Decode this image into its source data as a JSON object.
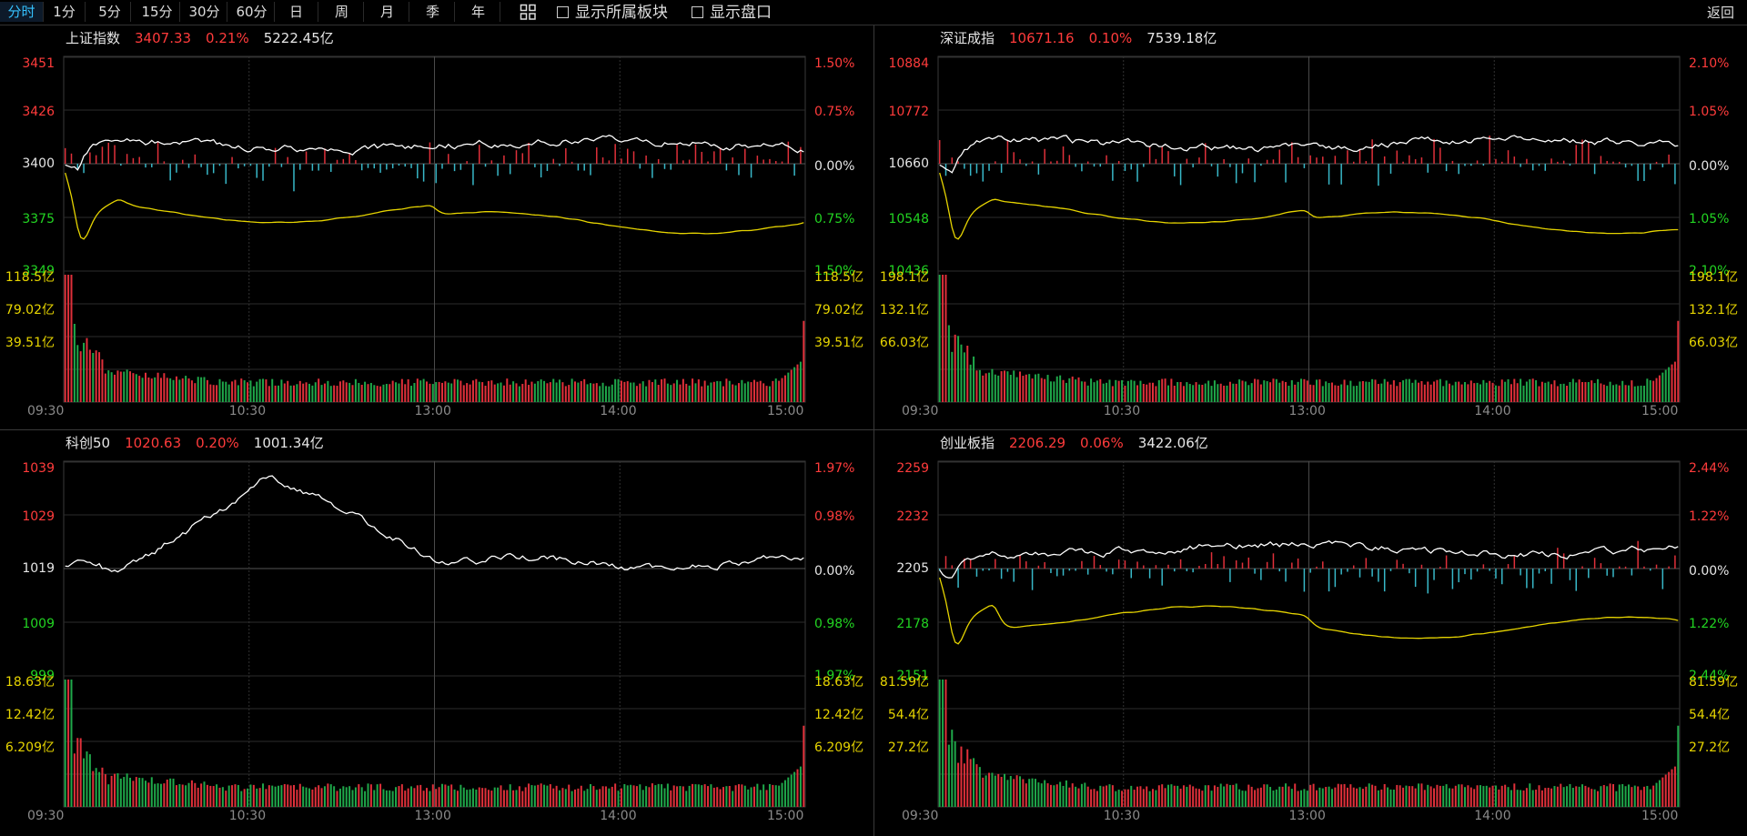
{
  "toolbar": {
    "tabs": [
      "分时",
      "1分",
      "5分",
      "15分",
      "30分",
      "60分",
      "日",
      "周",
      "月",
      "季",
      "年"
    ],
    "active_tab": "分时",
    "show_sector_label": "显示所属板块",
    "show_orderbook_label": "显示盘口",
    "back_label": "返回"
  },
  "colors": {
    "up": "#ff3b3b",
    "down": "#22d422",
    "price_line": "#ffffff",
    "avg_line": "#e6d400",
    "bar_up": "#e0303a",
    "bar_down": "#1fa84a",
    "diff_up": "#e0303a",
    "diff_down": "#38b8c8"
  },
  "time_labels": [
    "09:30",
    "10:30",
    "13:00",
    "14:00",
    "15:00"
  ],
  "panels": [
    {
      "name": "上证指数",
      "price": "3407.33",
      "change": "0.21%",
      "amount": "5222.45亿",
      "price_ticks": [
        "3451",
        "3426",
        "3400",
        "3375",
        "3349"
      ],
      "pct_ticks": [
        "1.50%",
        "0.75%",
        "0.00%",
        "0.75%",
        "1.50%"
      ],
      "vol_ticks": [
        "118.5亿",
        "79.02亿",
        "39.51亿"
      ],
      "show_diff": true,
      "seed": 11
    },
    {
      "name": "深证成指",
      "price": "10671.16",
      "change": "0.10%",
      "amount": "7539.18亿",
      "price_ticks": [
        "10884",
        "10772",
        "10660",
        "10548",
        "10436"
      ],
      "pct_ticks": [
        "2.10%",
        "1.05%",
        "0.00%",
        "1.05%",
        "2.10%"
      ],
      "vol_ticks": [
        "198.1亿",
        "132.1亿",
        "66.03亿"
      ],
      "show_diff": true,
      "seed": 23
    },
    {
      "name": "科创50",
      "price": "1020.63",
      "change": "0.20%",
      "amount": "1001.34亿",
      "price_ticks": [
        "1039",
        "1029",
        "1019",
        "1009",
        "999"
      ],
      "pct_ticks": [
        "1.97%",
        "0.98%",
        "0.00%",
        "0.98%",
        "1.97%"
      ],
      "vol_ticks": [
        "18.63亿",
        "12.42亿",
        "6.209亿"
      ],
      "show_diff": false,
      "seed": 37
    },
    {
      "name": "创业板指",
      "price": "2206.29",
      "change": "0.06%",
      "amount": "3422.06亿",
      "price_ticks": [
        "2259",
        "2232",
        "2205",
        "2178",
        "2151"
      ],
      "pct_ticks": [
        "2.44%",
        "1.22%",
        "0.00%",
        "1.22%",
        "2.44%"
      ],
      "vol_ticks": [
        "81.59亿",
        "54.4亿",
        "27.2亿"
      ],
      "show_diff": true,
      "seed": 51
    }
  ]
}
